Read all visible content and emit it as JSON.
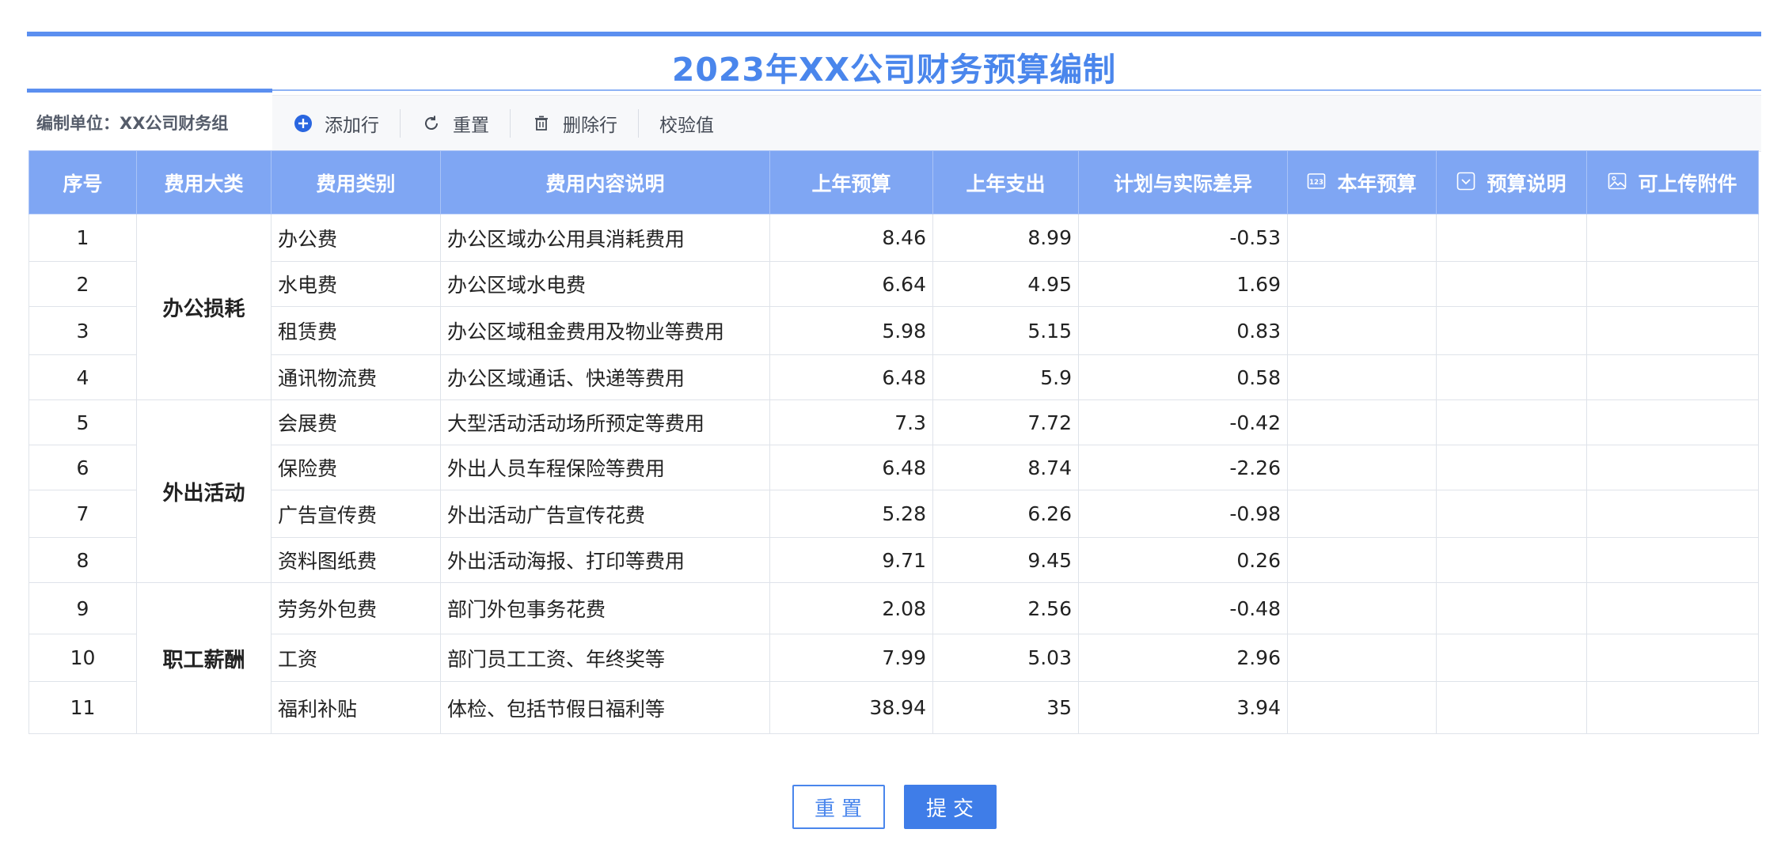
{
  "title": "2023年XX公司财务预算编制",
  "toolbar": {
    "unit_label": "编制单位：XX公司财务组",
    "add_row": "添加行",
    "reset": "重置",
    "delete_row": "删除行",
    "validate": "校验值"
  },
  "table": {
    "headers": [
      "序号",
      "费用大类",
      "费用类别",
      "费用内容说明",
      "上年预算",
      "上年支出",
      "计划与实际差异",
      "本年预算",
      "预算说明",
      "可上传附件"
    ],
    "header_icons": [
      "number-input-icon",
      "dropdown-select-icon",
      "image-upload-icon"
    ],
    "groups": [
      {
        "category": "办公损耗",
        "rows": [
          {
            "no": "1",
            "type": "办公费",
            "desc": "办公区域办公用具消耗费用",
            "prev_budget": "8.46",
            "prev_spend": "8.99",
            "diff": "-0.53"
          },
          {
            "no": "2",
            "type": "水电费",
            "desc": "办公区域水电费",
            "prev_budget": "6.64",
            "prev_spend": "4.95",
            "diff": "1.69"
          },
          {
            "no": "3",
            "type": "租赁费",
            "desc": "办公区域租金费用及物业等费用",
            "prev_budget": "5.98",
            "prev_spend": "5.15",
            "diff": "0.83"
          },
          {
            "no": "4",
            "type": "通讯物流费",
            "desc": "办公区域通话、快递等费用",
            "prev_budget": "6.48",
            "prev_spend": "5.9",
            "diff": "0.58"
          }
        ]
      },
      {
        "category": "外出活动",
        "rows": [
          {
            "no": "5",
            "type": "会展费",
            "desc": "大型活动活动场所预定等费用",
            "prev_budget": "7.3",
            "prev_spend": "7.72",
            "diff": "-0.42"
          },
          {
            "no": "6",
            "type": "保险费",
            "desc": "外出人员车程保险等费用",
            "prev_budget": "6.48",
            "prev_spend": "8.74",
            "diff": "-2.26"
          },
          {
            "no": "7",
            "type": "广告宣传费",
            "desc": "外出活动广告宣传花费",
            "prev_budget": "5.28",
            "prev_spend": "6.26",
            "diff": "-0.98"
          },
          {
            "no": "8",
            "type": "资料图纸费",
            "desc": "外出活动海报、打印等费用",
            "prev_budget": "9.71",
            "prev_spend": "9.45",
            "diff": "0.26"
          }
        ]
      },
      {
        "category": "职工薪酬",
        "rows": [
          {
            "no": "9",
            "type": "劳务外包费",
            "desc": "部门外包事务花费",
            "prev_budget": "2.08",
            "prev_spend": "2.56",
            "diff": "-0.48"
          },
          {
            "no": "10",
            "type": "工资",
            "desc": "部门员工工资、年终奖等",
            "prev_budget": "7.99",
            "prev_spend": "5.03",
            "diff": "2.96"
          },
          {
            "no": "11",
            "type": "福利补贴",
            "desc": "体检、包括节假日福利等",
            "prev_budget": "38.94",
            "prev_spend": "35",
            "diff": "3.94"
          }
        ]
      }
    ]
  },
  "footer": {
    "reset_label": "重置",
    "submit_label": "提交"
  },
  "colors": {
    "accent": "#4a86ec",
    "header_bg": "#7fa6f3",
    "toolbar_bg": "#f7f8fa"
  }
}
